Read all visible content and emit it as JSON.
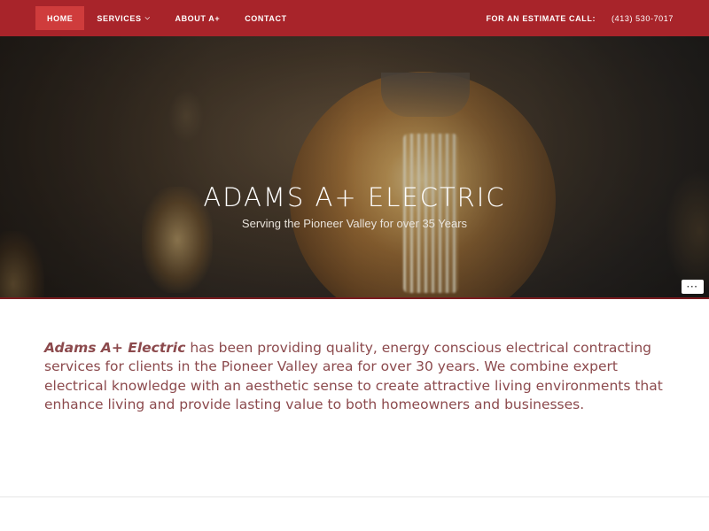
{
  "nav": {
    "items": [
      {
        "label": "Home",
        "active": true
      },
      {
        "label": "Services",
        "dropdown": true
      },
      {
        "label": "About A+"
      },
      {
        "label": "Contact"
      }
    ],
    "phone_label": "For an Estimate Call:",
    "phone": "(413) 530-7017",
    "chevron_icon": "chevron-down-icon"
  },
  "hero": {
    "title": "ADAMS A+ ELECTRIC",
    "subtitle": "Serving the Pioneer Valley for over 35 Years",
    "more_label": "···"
  },
  "intro": {
    "brand": "Adams A+ Electric",
    "text": " has been providing quality, energy conscious electrical contracting services for clients in the Pioneer Valley area for over 30 years. We combine expert electrical knowledge with an aesthetic sense to create attractive living environments that enhance living and provide lasting value to both homeowners and businesses."
  },
  "colors": {
    "nav_bg": "#a8242a",
    "nav_active": "#cf3c3c",
    "text": "#8c4a4d"
  }
}
